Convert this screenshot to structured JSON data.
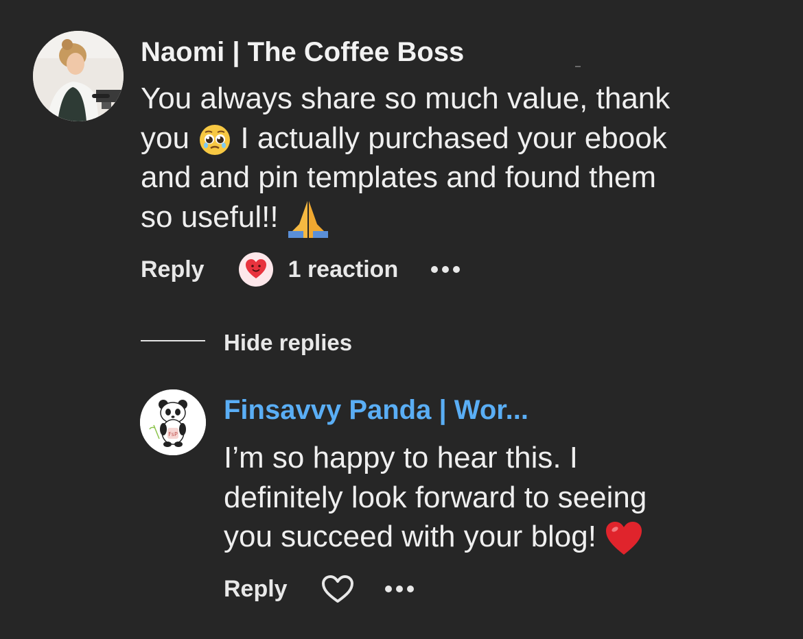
{
  "comment": {
    "author": "Naomi | The Coffee Boss",
    "avatar_icon": "profile-photo",
    "text_before_emoji": "You always share so much value, thank\nyou ",
    "emoji_1": "pleading-face",
    "text_after_emoji": " I actually purchased your ebook\nand and pin templates and found them\nso useful!! ",
    "emoji_2": "folded-hands",
    "reply_label": "Reply",
    "reaction_icon": "heart-face-icon",
    "reaction_count": "1 reaction",
    "more_icon": "more-options-icon"
  },
  "thread": {
    "hide_replies_label": "Hide replies"
  },
  "reply": {
    "author": "Finsavvy Panda | Wor...",
    "author_color": "#5aaef5",
    "avatar_icon": "panda-logo",
    "text": "I’m so happy to hear this. I\ndefinitely look forward to seeing\nyou succeed with your blog! ",
    "emoji": "red-heart",
    "reply_label": "Reply",
    "like_icon": "heart-outline-icon",
    "more_icon": "more-options-icon"
  }
}
